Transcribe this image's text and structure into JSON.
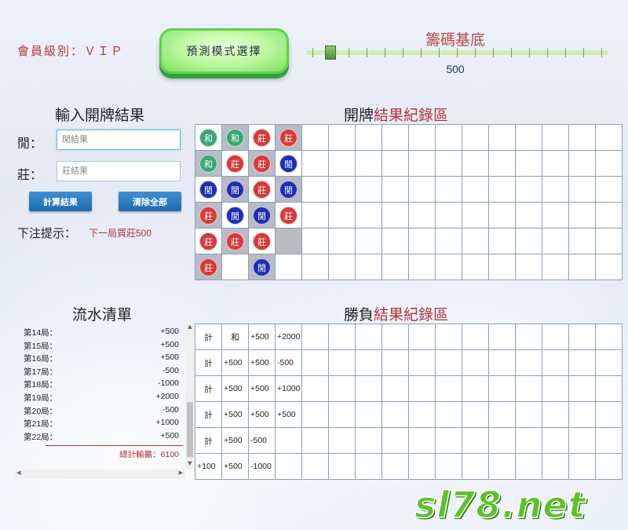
{
  "header": {
    "member_level": "會員級別：ＶＩＰ",
    "mode_button": "預測模式選擇",
    "chip_label": "籌碼基底",
    "chip_value": "500",
    "chip_slider_fraction": 0.07
  },
  "input_panel": {
    "title": "輸入開牌結果",
    "player_label": "閒：",
    "player_placeholder": "閒結果",
    "banker_label": "莊：",
    "banker_placeholder": "莊結果",
    "calc_button": "計算結果",
    "clear_button": "清除全部",
    "hint_label": "下注提示：",
    "hint_value": "下一局買莊500"
  },
  "record": {
    "title_prefix": "開牌",
    "title_suffix": "結果紀錄區",
    "columns": [
      [
        {
          "t": "和",
          "c": "green"
        },
        {
          "t": "和",
          "c": "green"
        },
        {
          "t": "閒",
          "c": "blue"
        },
        {
          "t": "莊",
          "c": "red"
        },
        {
          "t": "莊",
          "c": "red"
        },
        {
          "t": "莊",
          "c": "red"
        }
      ],
      [
        {
          "t": "和",
          "c": "green"
        },
        {
          "t": "莊",
          "c": "red"
        },
        {
          "t": "閒",
          "c": "blue"
        },
        {
          "t": "閒",
          "c": "blue"
        },
        {
          "t": "莊",
          "c": "red"
        },
        null
      ],
      [
        {
          "t": "莊",
          "c": "red"
        },
        {
          "t": "莊",
          "c": "red"
        },
        {
          "t": "莊",
          "c": "red"
        },
        {
          "t": "閒",
          "c": "blue"
        },
        {
          "t": "莊",
          "c": "red"
        },
        {
          "t": "閒",
          "c": "blue"
        }
      ],
      [
        {
          "t": "莊",
          "c": "red"
        },
        {
          "t": "閒",
          "c": "blue"
        },
        {
          "t": "閒",
          "c": "blue"
        },
        {
          "t": "莊",
          "c": "red"
        },
        null,
        null
      ]
    ]
  },
  "ledger": {
    "title": "流水清單",
    "rows": [
      {
        "round": "第14局：",
        "amount": "+500"
      },
      {
        "round": "第15局：",
        "amount": "+500"
      },
      {
        "round": "第16局：",
        "amount": "+500"
      },
      {
        "round": "第17局：",
        "amount": "-500"
      },
      {
        "round": "第18局：",
        "amount": "-1000"
      },
      {
        "round": "第19局：",
        "amount": "+2000"
      },
      {
        "round": "第20局：",
        "amount": "-500"
      },
      {
        "round": "第21局：",
        "amount": "+1000"
      },
      {
        "round": "第22局：",
        "amount": "+500"
      }
    ],
    "total": "總計輸贏：6100"
  },
  "results": {
    "title_prefix": "勝負",
    "title_suffix": "結果紀錄區",
    "columns": [
      [
        "計",
        "計",
        "計",
        "計",
        "計",
        "+100"
      ],
      [
        "和",
        "+500",
        "+500",
        "+500",
        "+500",
        "+500"
      ],
      [
        "+500",
        "+500",
        "+500",
        "+500",
        "-500",
        "-1000"
      ],
      [
        "+2000",
        "-500",
        "+1000",
        "+500",
        "",
        ""
      ]
    ]
  },
  "watermark": "sl78.net"
}
